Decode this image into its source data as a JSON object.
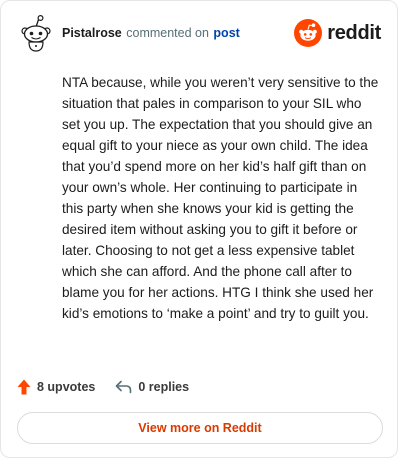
{
  "header": {
    "username": "Pistalrose",
    "action_text": "commented on",
    "post_link": "post"
  },
  "brand": {
    "name": "reddit",
    "accent_color": "#ff4500"
  },
  "comment": {
    "text": "NTA because, while you weren’t very sensitive to the situation that pales in comparison to your SIL who set you up. The expectation that you should give an equal gift to your niece as your own child. The idea that you’d spend more on her kid’s half gift than on your own’s whole. Her continuing to participate in this party when she knows your kid is getting the desired item without asking you to gift it before or later. Choosing to not get a less expensive tablet which she can afford. And the phone call after to blame you for her actions. HTG I think she used her kid’s emotions to ‘make a point’ and try to guilt you."
  },
  "stats": {
    "upvotes": "8 upvotes",
    "replies": "0 replies"
  },
  "footer": {
    "view_more_label": "View more on Reddit"
  },
  "icons": [
    "avatar-snoo-icon",
    "reddit-logo-icon",
    "upvote-arrow-icon",
    "reply-icon"
  ]
}
